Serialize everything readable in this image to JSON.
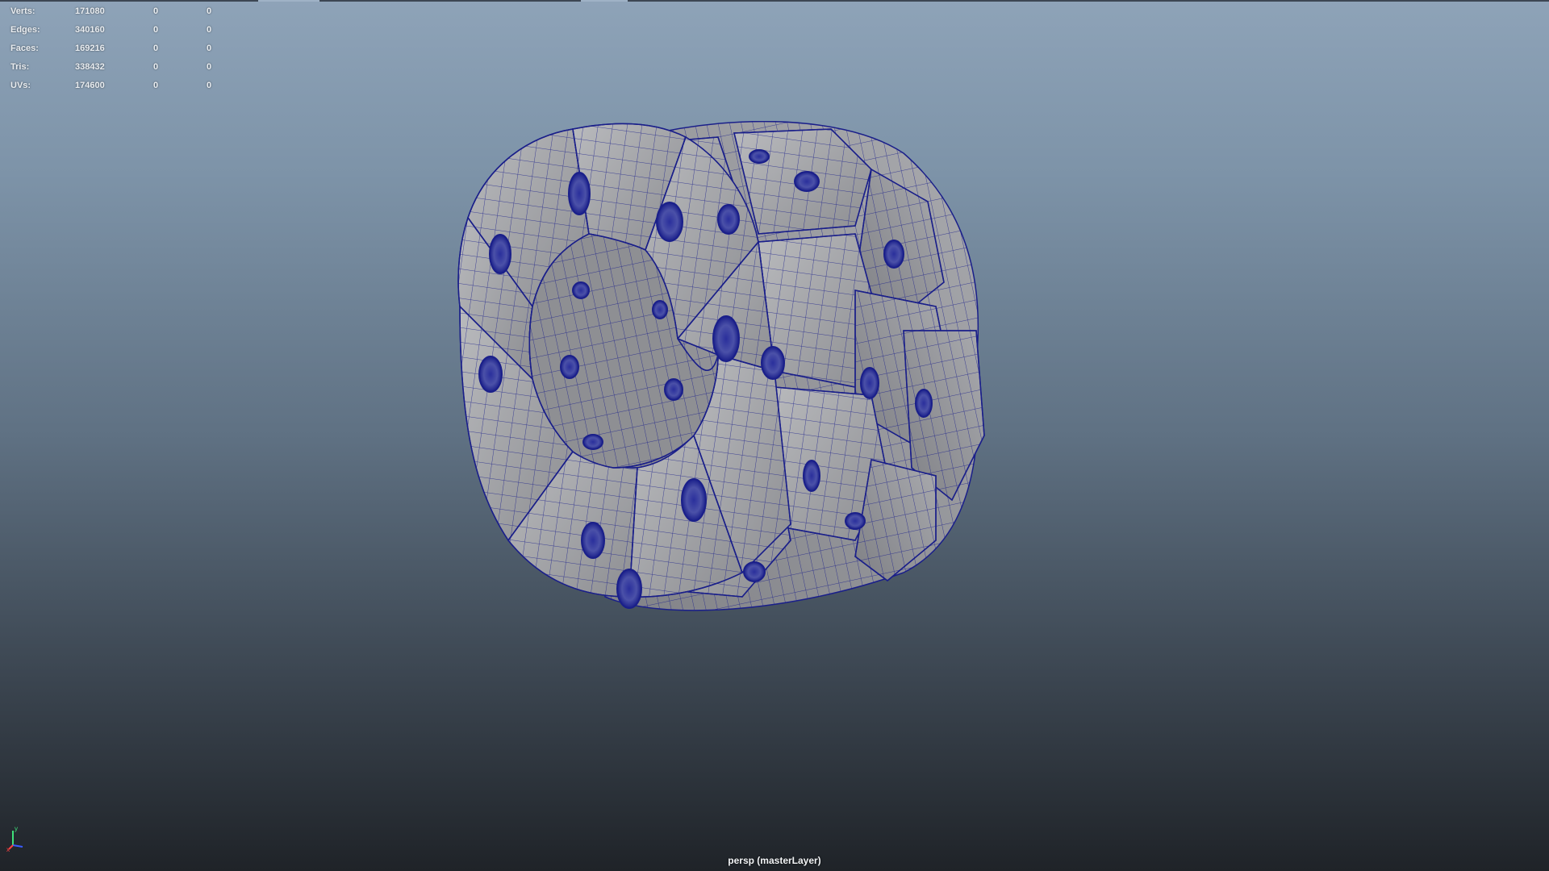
{
  "hud": {
    "rows": [
      {
        "label": "Verts:",
        "total": "171080",
        "selected": "0",
        "extra": "0"
      },
      {
        "label": "Edges:",
        "total": "340160",
        "selected": "0",
        "extra": "0"
      },
      {
        "label": "Faces:",
        "total": "169216",
        "selected": "0",
        "extra": "0"
      },
      {
        "label": "Tris:",
        "total": "338432",
        "selected": "0",
        "extra": "0"
      },
      {
        "label": "UVs:",
        "total": "174600",
        "selected": "0",
        "extra": "0"
      }
    ]
  },
  "viewport": {
    "camera_label": "persp (masterLayer)",
    "axis": {
      "y": "y",
      "x": "x"
    },
    "colors": {
      "background_top": "#8ea3b8",
      "background_bottom": "#1f2328",
      "wireframe": "#1a1f8a",
      "mesh_fill": "#a8a9ad"
    }
  }
}
